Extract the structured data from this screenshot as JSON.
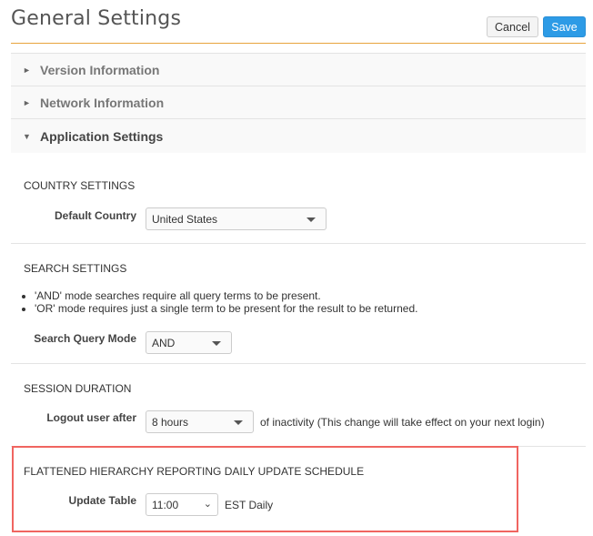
{
  "header": {
    "title": "General Settings",
    "cancel_label": "Cancel",
    "save_label": "Save",
    "accent_color": "#e8a33d",
    "save_color": "#2d9be6"
  },
  "accordion": [
    {
      "label": "Version Information",
      "expanded": false,
      "icon": "triangle-right-icon",
      "glyph": "►"
    },
    {
      "label": "Network Information",
      "expanded": false,
      "icon": "triangle-right-icon",
      "glyph": "►"
    },
    {
      "label": "Application Settings",
      "expanded": true,
      "icon": "triangle-down-icon",
      "glyph": "▼"
    }
  ],
  "country_settings": {
    "title": "COUNTRY SETTINGS",
    "default_country_label": "Default Country",
    "default_country_value": "United States"
  },
  "search_settings": {
    "title": "SEARCH SETTINGS",
    "bullets": [
      "'AND' mode searches require all query terms to be present.",
      "'OR' mode requires just a single term to be present for the result to be returned."
    ],
    "query_mode_label": "Search Query Mode",
    "query_mode_value": "AND"
  },
  "session_duration": {
    "title": "SESSION DURATION",
    "logout_label": "Logout user after",
    "logout_value": "8 hours",
    "logout_suffix": "of inactivity (This change will take effect on your next login)"
  },
  "flattened_hierarchy": {
    "title": "FLATTENED HIERARCHY REPORTING DAILY UPDATE SCHEDULE",
    "update_label": "Update Table",
    "update_value": "11:00",
    "update_suffix": "EST Daily",
    "highlight_color": "#f06560"
  }
}
